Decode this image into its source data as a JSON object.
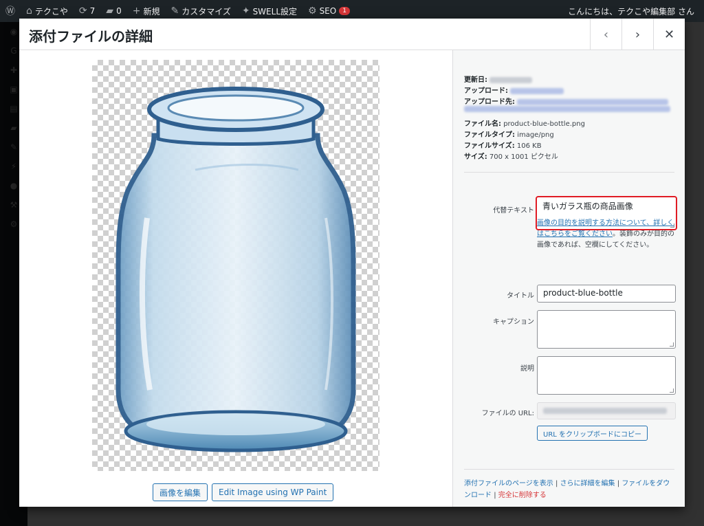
{
  "adminbar": {
    "site_name": "テクこや",
    "updates": "7",
    "comments": "0",
    "new": "新規",
    "customize": "カスタマイズ",
    "swell": "SWELL設定",
    "seo": "SEO",
    "seo_badge": "1",
    "greeting": "こんにちは、テクこや編集部 さん"
  },
  "modal": {
    "title": "添付ファイルの詳細",
    "prev_icon": "chevron-left-icon",
    "next_icon": "chevron-right-icon",
    "close_icon": "close-icon"
  },
  "media": {
    "edit_image_button": "画像を編集",
    "wp_paint_button": "Edit Image using WP Paint"
  },
  "details": {
    "updated_label": "更新日:",
    "uploaded_label": "アップロード:",
    "uploaded_to_label": "アップロード先:",
    "filename_label": "ファイル名:",
    "filename_value": "product-blue-bottle.png",
    "filetype_label": "ファイルタイプ:",
    "filetype_value": "image/png",
    "filesize_label": "ファイルサイズ:",
    "filesize_value": "106 KB",
    "dimensions_label": "サイズ:",
    "dimensions_value": "700 x 1001 ピクセル"
  },
  "form": {
    "alt_label": "代替テキスト",
    "alt_value": "青いガラス瓶の商品画像",
    "alt_help_link": "画像の目的を説明する方法について、詳しくはこちらをご覧ください",
    "alt_help_text": "。装飾のみが目的の画像であれば、空欄にしてください。",
    "title_label": "タイトル",
    "title_value": "product-blue-bottle",
    "caption_label": "キャプション",
    "caption_value": "",
    "description_label": "説明",
    "description_value": "",
    "url_label": "ファイルの URL:",
    "copy_url_button": "URL をクリップボードにコピー"
  },
  "links": {
    "view_page": "添付ファイルのページを表示",
    "edit_more": "さらに詳細を編集",
    "download": "ファイルをダウンロード",
    "delete": "完全に削除する"
  },
  "colors": {
    "accent": "#2271b1",
    "danger": "#d63638",
    "highlight_border": "#e01b24"
  }
}
